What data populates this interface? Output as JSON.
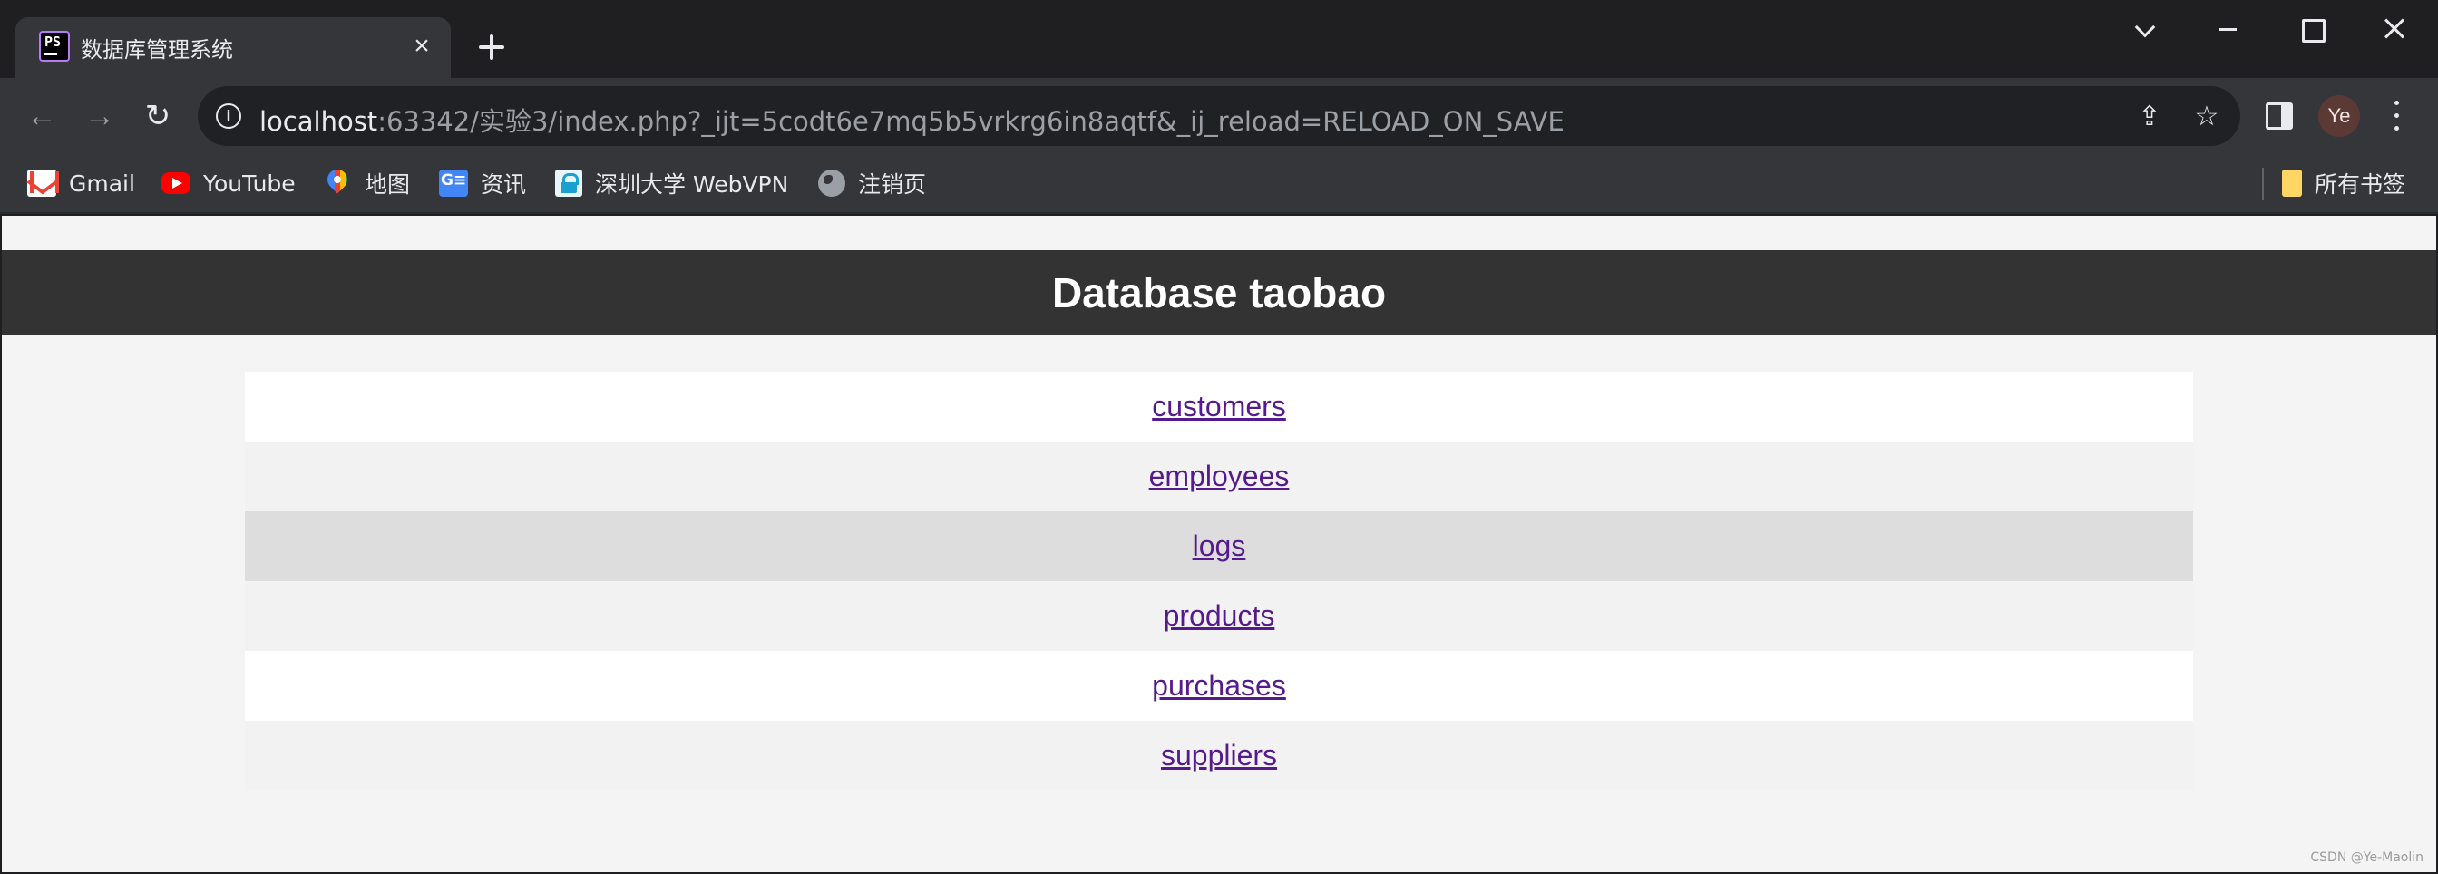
{
  "browser": {
    "tab": {
      "favicon_text": "PS",
      "title": "数据库管理系统",
      "close": "×"
    },
    "toolbar": {
      "back": "←",
      "forward": "→",
      "reload": "↻",
      "site_info": "i",
      "url_host": "localhost",
      "url_rest": ":63342/实验3/index.php?_ijt=5codt6e7mq5b5vrkrg6in8aqtf&_ij_reload=RELOAD_ON_SAVE",
      "share": "⇪",
      "star": "☆",
      "avatar": "Ye"
    },
    "bookmarks": [
      {
        "label": "Gmail",
        "icon": "gmail-icon"
      },
      {
        "label": "YouTube",
        "icon": "youtube-icon"
      },
      {
        "label": "地图",
        "icon": "maps-icon"
      },
      {
        "label": "资讯",
        "icon": "news-icon"
      },
      {
        "label": "深圳大学 WebVPN",
        "icon": "vpn-lock-icon"
      },
      {
        "label": "注销页",
        "icon": "globe-icon"
      }
    ],
    "all_bookmarks": "所有书签"
  },
  "page": {
    "title": "Database taobao",
    "tables": [
      "customers",
      "employees",
      "logs",
      "products",
      "purchases",
      "suppliers"
    ],
    "watermark": "CSDN @Ye-Maolin"
  }
}
